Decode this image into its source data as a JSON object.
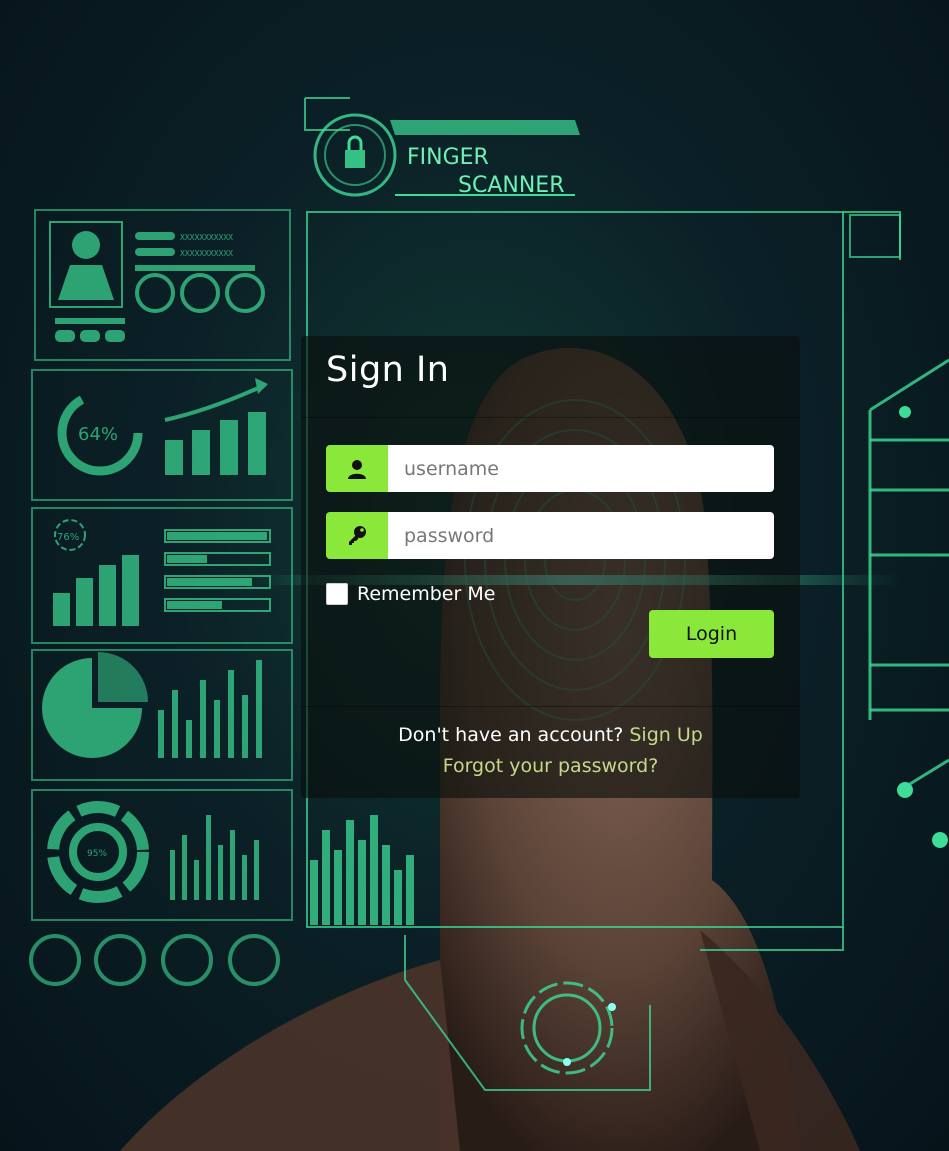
{
  "banner": {
    "line1": "FINGER",
    "line2": "SCANNER"
  },
  "hud": {
    "gauge_percent": "64%",
    "small_percent": "76%",
    "donut_percent": "95%",
    "bar_text": "XXXXXXXXXXX"
  },
  "signin": {
    "title": "Sign In",
    "username_placeholder": "username",
    "password_placeholder": "password",
    "username_icon": "user-icon",
    "password_icon": "key-icon",
    "remember_label": "Remember Me",
    "login_label": "Login",
    "no_account_text": "Don't have an account?",
    "signup_link": "Sign Up",
    "forgot_link": "Forgot your password?"
  },
  "colors": {
    "accent": "#8ae83a",
    "link": "#c5d98a",
    "hud": "#3ddc97",
    "card_bg": "rgba(10,14,12,0.62)"
  }
}
